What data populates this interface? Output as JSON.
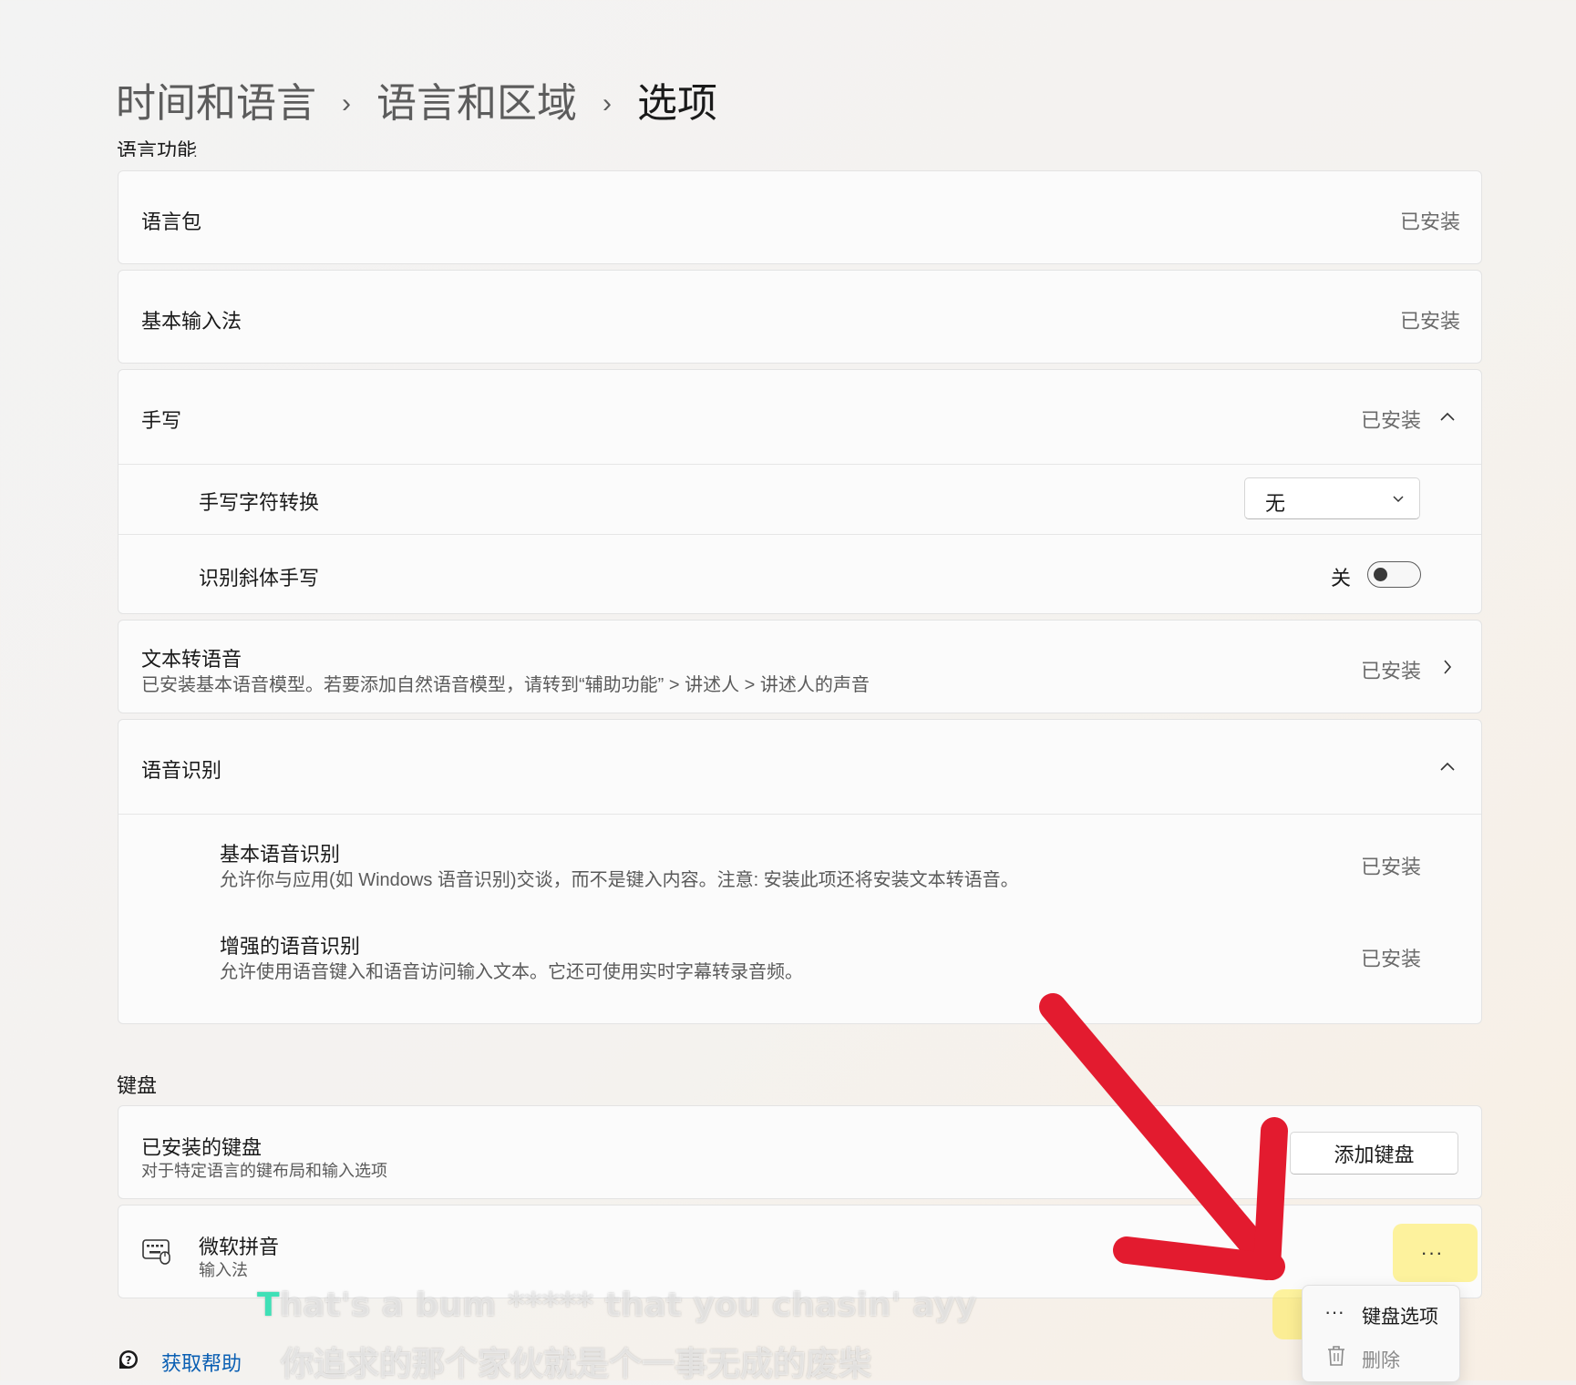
{
  "breadcrumb": {
    "items": [
      "时间和语言",
      "语言和区域"
    ],
    "separator": "›",
    "current": "选项"
  },
  "language_features_heading": "语言功能",
  "features": {
    "language_pack": {
      "label": "语言包",
      "status": "已安装"
    },
    "basic_ime": {
      "label": "基本输入法",
      "status": "已安装"
    },
    "handwriting": {
      "label": "手写",
      "status": "已安装",
      "char_conversion": {
        "label": "手写字符转换",
        "value": "无"
      },
      "italic_recognition": {
        "label": "识别斜体手写",
        "state_label": "关",
        "on": false
      }
    },
    "tts": {
      "label": "文本转语音",
      "desc": "已安装基本语音模型。若要添加自然语音模型，请转到“辅助功能” > 讲述人 > 讲述人的声音",
      "status": "已安装"
    },
    "speech_recognition": {
      "label": "语音识别",
      "basic": {
        "label": "基本语音识别",
        "desc": "允许你与应用(如 Windows 语音识别)交谈，而不是键入内容。注意: 安装此项还将安装文本转语音。",
        "status": "已安装"
      },
      "enhanced": {
        "label": "增强的语音识别",
        "desc": "允许使用语音键入和语音访问输入文本。它还可使用实时字幕转录音频。",
        "status": "已安装"
      }
    }
  },
  "keyboard": {
    "heading": "键盘",
    "installed": {
      "label": "已安装的键盘",
      "desc": "对于特定语言的键布局和输入选项",
      "add_button": "添加键盘"
    },
    "item": {
      "name": "微软拼音",
      "type": "输入法",
      "more": "···",
      "icon": "keyboard-icon"
    }
  },
  "context_menu": {
    "items": [
      {
        "label": "键盘选项",
        "icon": "more-icon",
        "glyph": "···"
      },
      {
        "label": "删除",
        "icon": "trash-icon"
      }
    ]
  },
  "help": {
    "label": "获取帮助"
  },
  "captions": {
    "en": "That's a bum ***** that you chasin' ayy",
    "zh": "你追求的那个家伙就是个一事无成的废柴"
  },
  "colors": {
    "accent_link": "#0a5fb3",
    "annotation_arrow": "#e31b2f",
    "highlight": "#ffeb50",
    "caption_first_letter": "#3fe0b6"
  }
}
